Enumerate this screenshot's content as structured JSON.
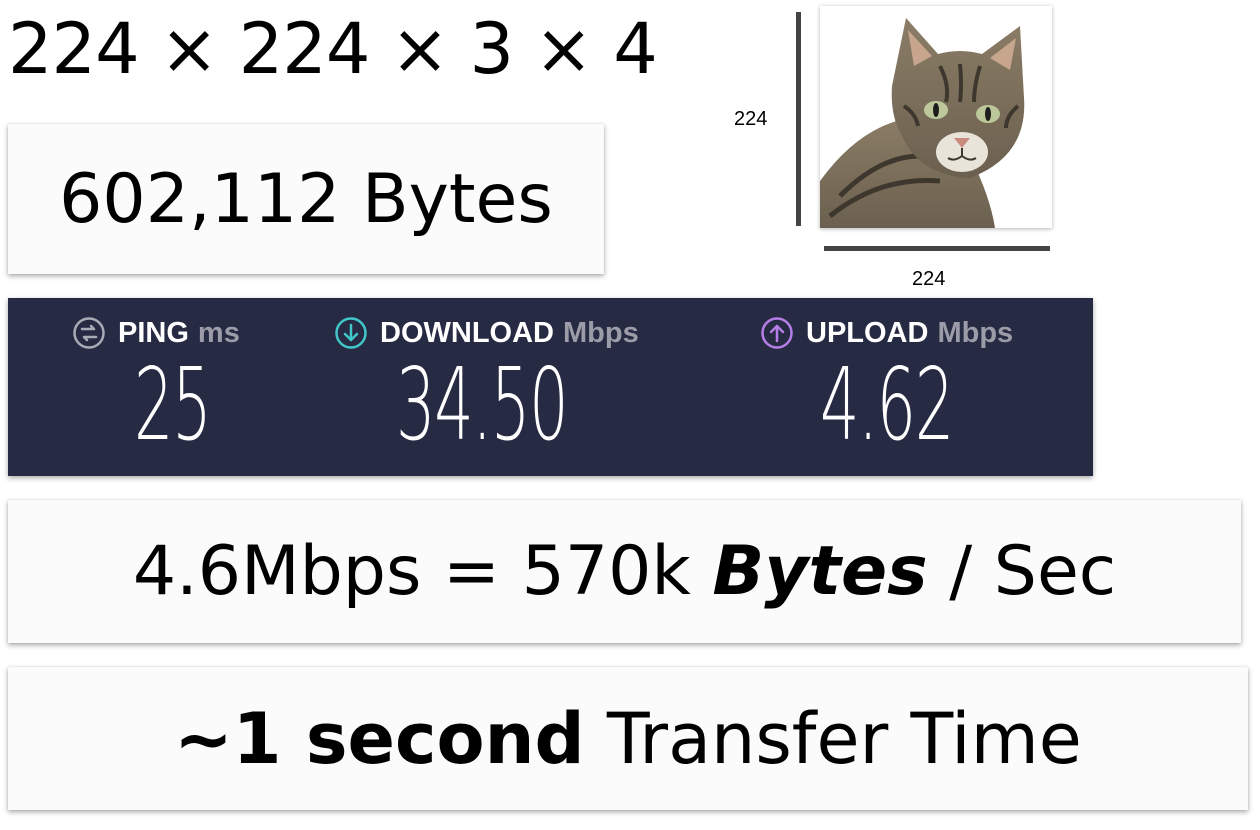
{
  "formula": "224 × 224 × 3 × 4",
  "bytes_total": "602,112 Bytes",
  "image": {
    "height_label": "224",
    "width_label": "224"
  },
  "speedtest": {
    "ping": {
      "label": "PING",
      "unit": "ms",
      "value": "25",
      "icon": "ping-icon"
    },
    "download": {
      "label": "DOWNLOAD",
      "unit": "Mbps",
      "value": "34.50",
      "icon": "download-icon"
    },
    "upload": {
      "label": "UPLOAD",
      "unit": "Mbps",
      "value": "4.62",
      "icon": "upload-icon"
    }
  },
  "rate": {
    "part1": "4.6Mbps = 570k ",
    "emph": "Bytes",
    "part2": " / Sec"
  },
  "transfer": {
    "emph": "~1 second",
    "rest": " Transfer Time"
  },
  "colors": {
    "panel_bg": "#272a43",
    "ping_icon": "#a8aab6",
    "download_icon": "#41c7c9",
    "upload_icon": "#b57ee6"
  }
}
